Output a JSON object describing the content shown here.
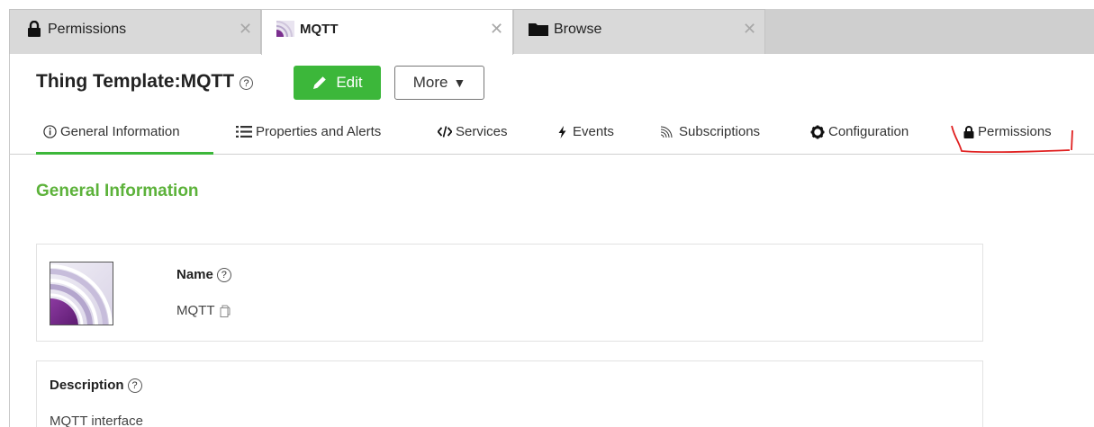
{
  "tabs": [
    {
      "label": "Permissions",
      "icon": "lock-icon",
      "active": false
    },
    {
      "label": "MQTT",
      "icon": "mqtt-icon",
      "active": true
    },
    {
      "label": "Browse",
      "icon": "folder-icon",
      "active": false
    }
  ],
  "header": {
    "prefix": "Thing Template:",
    "name": "MQTT",
    "help": "?",
    "edit_label": "Edit",
    "more_label": "More"
  },
  "subnav": {
    "items": [
      {
        "label": "General Information",
        "icon": "info-icon"
      },
      {
        "label": "Properties and Alerts",
        "icon": "list-icon"
      },
      {
        "label": "Services",
        "icon": "code-icon"
      },
      {
        "label": "Events",
        "icon": "lightning-icon"
      },
      {
        "label": "Subscriptions",
        "icon": "rss-icon"
      },
      {
        "label": "Configuration",
        "icon": "gear-icon"
      },
      {
        "label": "Permissions",
        "icon": "lock-icon"
      }
    ],
    "active_index": 0
  },
  "main": {
    "section_title": "General Information",
    "name_label": "Name",
    "name_value": "MQTT",
    "description_label": "Description",
    "description_value": "MQTT interface"
  },
  "colors": {
    "accent": "#3cb73a",
    "section_title": "#5cb23a",
    "annotation": "#e02020",
    "mqtt_purple": "#7b2f8f"
  }
}
